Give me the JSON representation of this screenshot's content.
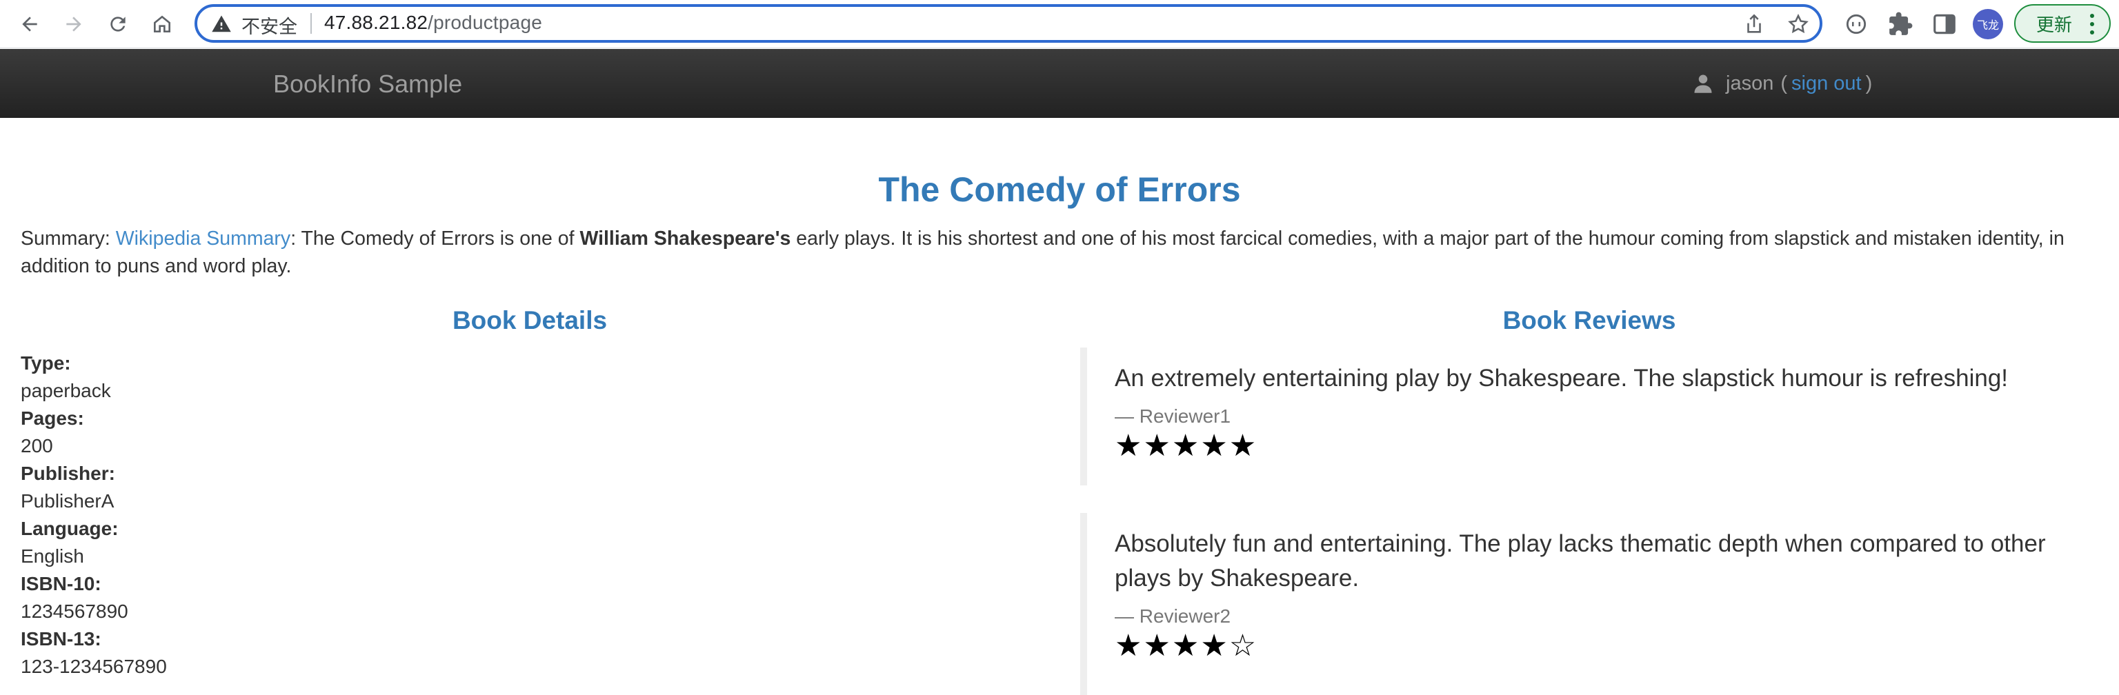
{
  "browser": {
    "insecure_label": "不安全",
    "url_host": "47.88.21.82",
    "url_path": "/productpage",
    "profile_label": "飞龙",
    "update_label": "更新"
  },
  "navbar": {
    "brand": "BookInfo Sample",
    "user": "jason",
    "open_paren": "(",
    "sign_out": "sign out",
    "close_paren": ")"
  },
  "book": {
    "title": "The Comedy of Errors",
    "summary_prefix": "Summary:",
    "summary_link": "Wikipedia Summary",
    "summary_part1": ": The Comedy of Errors is one of",
    "summary_bold": "William Shakespeare's",
    "summary_part2": "early plays. It is his shortest and one of his most farcical comedies, with a major part of the humour coming from slapstick and mistaken identity, in addition to puns and word play."
  },
  "details": {
    "heading": "Book Details",
    "items": [
      {
        "label": "Type:",
        "value": "paperback"
      },
      {
        "label": "Pages:",
        "value": "200"
      },
      {
        "label": "Publisher:",
        "value": "PublisherA"
      },
      {
        "label": "Language:",
        "value": "English"
      },
      {
        "label": "ISBN-10:",
        "value": "1234567890"
      },
      {
        "label": "ISBN-13:",
        "value": "123-1234567890"
      }
    ]
  },
  "reviews": {
    "heading": "Book Reviews",
    "items": [
      {
        "text": "An extremely entertaining play by Shakespeare. The slapstick humour is refreshing!",
        "reviewer": "— Reviewer1",
        "stars": "★★★★★",
        "rating": 5
      },
      {
        "text": "Absolutely fun and entertaining. The play lacks thematic depth when compared to other plays by Shakespeare.",
        "reviewer": "— Reviewer2",
        "stars": "★★★★☆",
        "rating": 4
      }
    ]
  },
  "colors": {
    "link": "#428bca",
    "heading": "#337ab7",
    "navbar": "#222222",
    "omnibox_focus": "#2e6ad1"
  }
}
